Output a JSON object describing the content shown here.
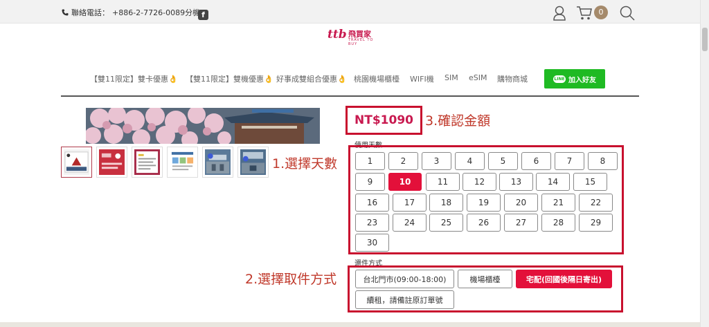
{
  "topbar": {
    "phone_label": "聯絡電話：",
    "phone_number": "+886-2-7726-0089分機9",
    "fb_glyph": "f",
    "cart_count": "0",
    "icons": [
      "phone-icon",
      "facebook-icon",
      "user-icon",
      "cart-icon",
      "search-icon"
    ]
  },
  "logo": {
    "mark": "ttb",
    "name": "飛買家",
    "sub": "TRAVEL TO BUY"
  },
  "nav": {
    "items": [
      "【雙11限定】雙卡優惠👌",
      "【雙11限定】雙機優惠👌",
      "好事成雙組合優惠👌",
      "桃園機場櫃檯",
      "WIFI機",
      "SIM",
      "eSIM",
      "購物商城"
    ],
    "line_logo": "LINE",
    "line_button": "加入好友"
  },
  "product": {
    "price": "NT$1090"
  },
  "annotations": {
    "step3": "3.確認金額",
    "step1": "1.選擇天數",
    "step2": "2.選擇取件方式"
  },
  "days": {
    "label": "使用天數",
    "options": [
      "1",
      "2",
      "3",
      "4",
      "5",
      "6",
      "7",
      "8",
      "9",
      "10",
      "11",
      "12",
      "13",
      "14",
      "15",
      "16",
      "17",
      "18",
      "19",
      "20",
      "21",
      "22",
      "23",
      "24",
      "25",
      "26",
      "27",
      "28",
      "29",
      "30"
    ],
    "selected": "10"
  },
  "pickup": {
    "label": "還件方式",
    "options": [
      "台北門市(09:00-18:00)",
      "機場櫃檯",
      "宅配(回國後隔日寄出)",
      "續租，請備註原訂單號"
    ],
    "selected": "宅配(回國後隔日寄出)"
  },
  "colors": {
    "accent_red": "#e3103a",
    "frame_red": "#c8102e",
    "line_green": "#1fba23",
    "badge_brown": "#a58a6b"
  }
}
